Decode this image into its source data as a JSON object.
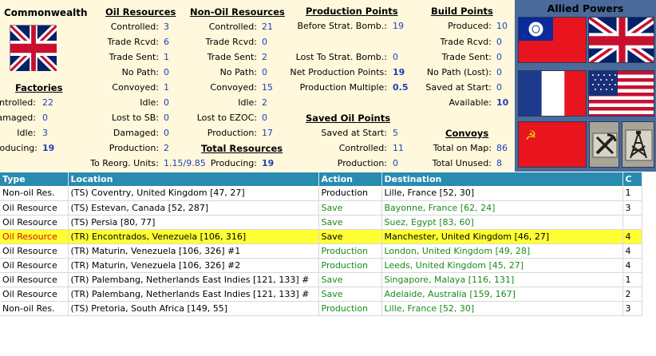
{
  "nation": "Commonwealth",
  "factories": {
    "heading": "Factories",
    "rows": [
      {
        "label": "Controlled:",
        "value": "22"
      },
      {
        "label": "Damaged:",
        "value": "0"
      },
      {
        "label": "Idle:",
        "value": "3"
      },
      {
        "label": "Producing:",
        "value": "19"
      }
    ]
  },
  "oil": {
    "heading": "Oil Resources",
    "rows": [
      {
        "label": "Controlled:",
        "value": "3"
      },
      {
        "label": "Trade Rcvd:",
        "value": "6"
      },
      {
        "label": "Trade Sent:",
        "value": "1"
      },
      {
        "label": "No Path:",
        "value": "0"
      },
      {
        "label": "Convoyed:",
        "value": "1"
      },
      {
        "label": "Idle:",
        "value": "0"
      },
      {
        "label": "Lost to SB:",
        "value": "0"
      },
      {
        "label": "Damaged:",
        "value": "0"
      },
      {
        "label": "Production:",
        "value": "2"
      }
    ],
    "reorg_label": "To Reorg. Units:",
    "reorg_value": "1.15/9.85"
  },
  "nonoil": {
    "heading": "Non-Oil Resources",
    "rows": [
      {
        "label": "Controlled:",
        "value": "21"
      },
      {
        "label": "Trade Rcvd:",
        "value": "0"
      },
      {
        "label": "Trade Sent:",
        "value": "2"
      },
      {
        "label": "No Path:",
        "value": "0"
      },
      {
        "label": "Convoyed:",
        "value": "15"
      },
      {
        "label": "Idle:",
        "value": "2"
      },
      {
        "label": "Lost to EZOC:",
        "value": "0"
      },
      {
        "label": "Production:",
        "value": "17"
      }
    ],
    "total_heading": "Total Resources",
    "total_label": "Producing:",
    "total_value": "19"
  },
  "production_points": {
    "heading": "Production Points",
    "before_label": "Before Strat. Bomb.:",
    "before_value": "19",
    "lost_label": "Lost To Strat. Bomb.:",
    "lost_value": "0",
    "net_label": "Net Production Points:",
    "net_value": "19",
    "mult_label": "Production Multiple:",
    "mult_value": "0.5"
  },
  "saved_oil": {
    "heading": "Saved Oil Points",
    "rows": [
      {
        "label": "Saved at Start:",
        "value": "5"
      },
      {
        "label": "Controlled:",
        "value": "11"
      },
      {
        "label": "Production:",
        "value": "0"
      }
    ]
  },
  "build_points": {
    "heading": "Build Points",
    "rows": [
      {
        "label": "Produced:",
        "value": "10"
      },
      {
        "label": "Trade Rcvd:",
        "value": "0"
      },
      {
        "label": "Trade Sent:",
        "value": "0"
      },
      {
        "label": "No Path (Lost):",
        "value": "0"
      },
      {
        "label": "Saved at Start:",
        "value": "0"
      },
      {
        "label": "Available:",
        "value": "10"
      }
    ]
  },
  "convoys": {
    "heading": "Convoys",
    "rows": [
      {
        "label": "Total on Map:",
        "value": "86"
      },
      {
        "label": "Total Unused:",
        "value": "8"
      }
    ]
  },
  "allied": {
    "title": "Allied Powers"
  },
  "grid": {
    "columns": [
      "Type",
      "Location",
      "Action",
      "Destination",
      "C"
    ],
    "rows": [
      {
        "type": "Non-oil Res.",
        "location": "(TS) Coventry, United Kingdom [47, 27]",
        "action": "Production",
        "destination": "Lille, France [52, 30]",
        "c": "1"
      },
      {
        "type": "Oil Resource",
        "location": "(TS) Estevan, Canada [52, 287]",
        "action": "Save",
        "destination": "Bayonne, France [62, 24]",
        "c": "3"
      },
      {
        "type": "Oil Resource",
        "location": "(TS) Persia [80, 77]",
        "action": "Save",
        "destination": "Suez, Egypt [83, 60]",
        "c": ""
      },
      {
        "type": "Oil Resource",
        "location": "(TR) Encontrados, Venezuela [106, 316]",
        "action": "Save",
        "destination": "Manchester, United Kingdom [46, 27]",
        "c": "4"
      },
      {
        "type": "Oil Resource",
        "location": "(TR) Maturin, Venezuela [106, 326] #1",
        "action": "Production",
        "destination": "London, United Kingdom [49, 28]",
        "c": "4"
      },
      {
        "type": "Oil Resource",
        "location": "(TR) Maturin, Venezuela [106, 326] #2",
        "action": "Production",
        "destination": "Leeds, United Kingdom [45, 27]",
        "c": "4"
      },
      {
        "type": "Oil Resource",
        "location": "(TR) Palembang, Netherlands East Indies [121, 133] #",
        "action": "Save",
        "destination": "Singapore, Malaya [116, 131]",
        "c": "1"
      },
      {
        "type": "Oil Resource",
        "location": "(TR) Palembang, Netherlands East Indies [121, 133] #",
        "action": "Save",
        "destination": "Adelaide, Australia [159, 167]",
        "c": "2"
      },
      {
        "type": "Non-oil Res.",
        "location": "(TS) Pretoria, South Africa [149, 55]",
        "action": "Production",
        "destination": "Lille, France [52, 30]",
        "c": "3"
      }
    ]
  }
}
